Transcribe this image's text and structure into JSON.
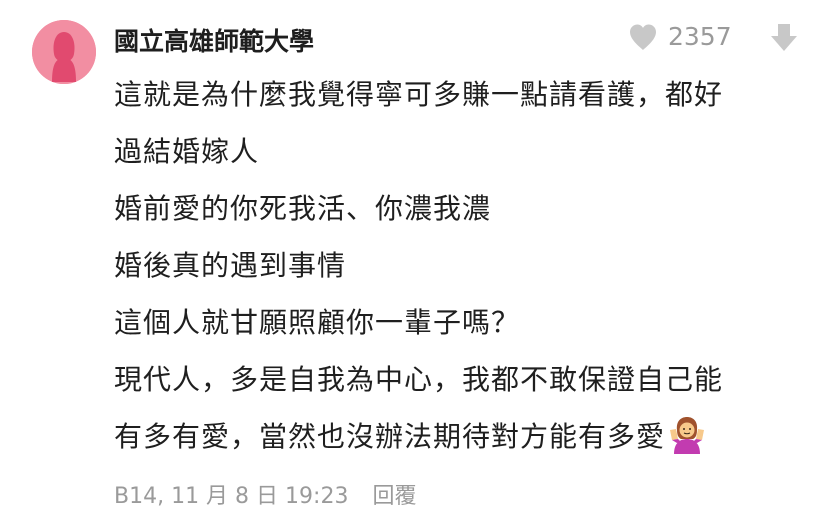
{
  "comment": {
    "author": "國立高雄師範大學",
    "like_count": "2357",
    "lines": [
      "這就是為什麼我覺得寧可多賺一點請看護，都好",
      "過結婚嫁人",
      "婚前愛的你死我活、你濃我濃",
      "婚後真的遇到事情",
      "這個人就甘願照顧你一輩子嗎？",
      "現代人，多是自我為中心，我都不敢保證自己能",
      "有多有愛，當然也沒辦法期待對方能有多愛"
    ],
    "emoji": "person-shrugging-emoji",
    "floor_time": "B14, 11 月 8 日 19:23",
    "reply_label": "回覆"
  },
  "icons": {
    "avatar": "female-avatar-icon",
    "like": "heart-icon",
    "downvote": "arrow-down-icon"
  },
  "colors": {
    "avatar_bg": "#f28ea2",
    "avatar_figure": "#e14a6f",
    "meta_text": "#9a9a9a",
    "icon_gray": "#c8c8c8"
  }
}
